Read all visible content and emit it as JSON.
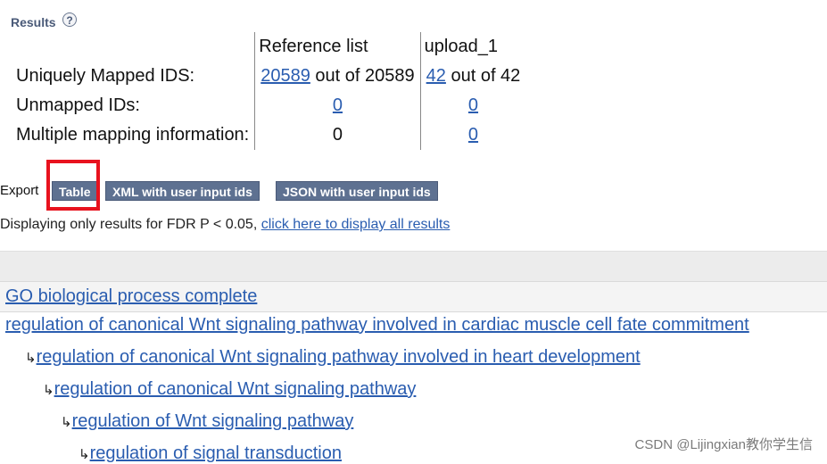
{
  "results": {
    "title": "Results",
    "help_icon": "question-mark-icon",
    "table": {
      "headers": [
        "",
        "Reference list",
        "upload_1"
      ],
      "rows": [
        {
          "label": "Uniquely Mapped IDS:",
          "ref_link": "20589",
          "ref_suffix": " out of 20589",
          "up_link": "42",
          "up_suffix": " out of 42"
        },
        {
          "label": "Unmapped IDs:",
          "ref_link": "0",
          "ref_suffix": "",
          "up_link": "0",
          "up_suffix": ""
        },
        {
          "label": "Multiple mapping information:",
          "ref_text": "0",
          "up_link": "0"
        }
      ]
    }
  },
  "export": {
    "label": "Export",
    "buttons": [
      "Table",
      "XML with user input ids",
      "JSON with user input ids"
    ],
    "highlight_color": "#e8121e"
  },
  "fdr": {
    "text": "Displaying only results for FDR P < 0.05, ",
    "link": "click here to display all results"
  },
  "go": {
    "header_link": "GO biological process complete",
    "tree": [
      "regulation of canonical Wnt signaling pathway involved in cardiac muscle cell fate commitment",
      "regulation of canonical Wnt signaling pathway involved in heart development",
      "regulation of canonical Wnt signaling pathway",
      "regulation of Wnt signaling pathway",
      "regulation of signal transduction"
    ],
    "arrow": "↳"
  },
  "watermark": "CSDN @Lijingxian教你学生信"
}
